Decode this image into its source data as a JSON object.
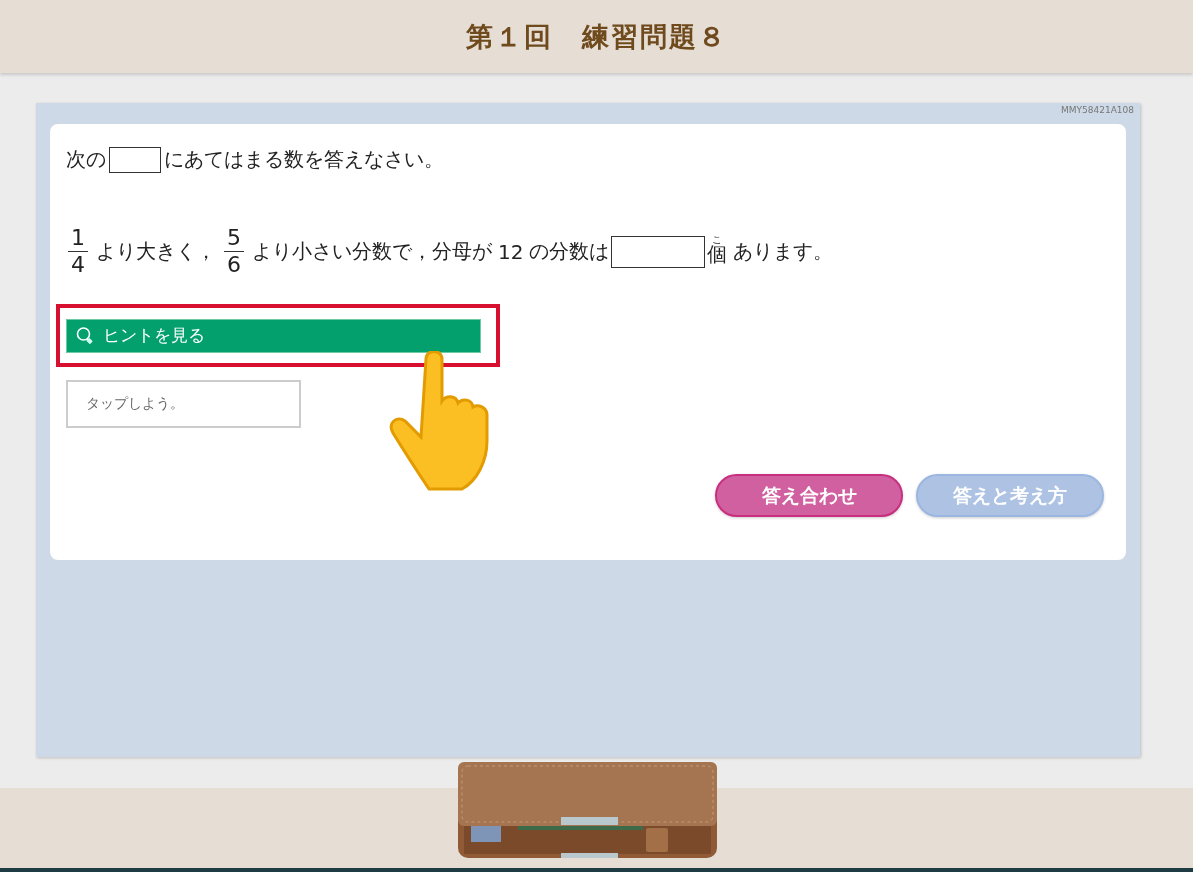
{
  "header": {
    "title": "第１回　練習問題８"
  },
  "panel": {
    "code": "MMY58421A108"
  },
  "instruction": {
    "before": "次の",
    "after": "にあてはまる数を答えなさい。"
  },
  "problem": [
    {
      "kind": "fraction",
      "numerator": "1",
      "denominator": "4"
    },
    {
      "kind": "text",
      "text": "より大きく，"
    },
    {
      "kind": "fraction",
      "numerator": "5",
      "denominator": "6"
    },
    {
      "kind": "text",
      "text": "より小さい分数で，分母が"
    },
    {
      "kind": "text",
      "text": "12"
    },
    {
      "kind": "text",
      "text": "の分数は"
    },
    {
      "kind": "blank"
    },
    {
      "kind": "ruby",
      "base": "個",
      "reading": "こ"
    },
    {
      "kind": "text",
      "text": "あります。"
    }
  ],
  "hint": {
    "label": "ヒントを見る",
    "highlighted": true
  },
  "hint_box": {
    "text": "タップしよう。"
  },
  "buttons": [
    {
      "label": "答え合わせ",
      "kind": "check"
    },
    {
      "label": "答えと考え方",
      "kind": "explain"
    }
  ]
}
